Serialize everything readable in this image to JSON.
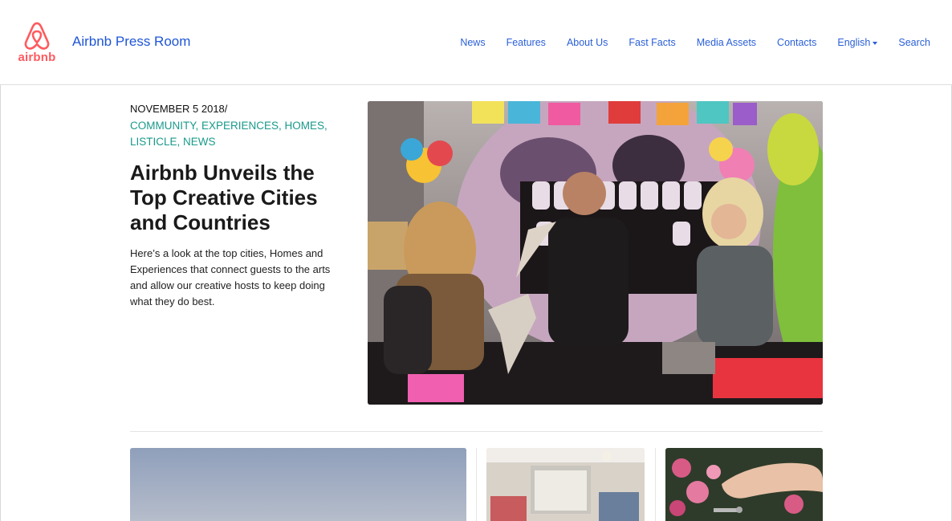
{
  "brand": {
    "logo_text": "airbnb",
    "site_title": "Airbnb Press Room",
    "accent": "#ff5a5f",
    "link_color": "#2a5fd8",
    "category_color": "#1a9a8a"
  },
  "nav": {
    "items": [
      {
        "label": "News"
      },
      {
        "label": "Features"
      },
      {
        "label": "About Us"
      },
      {
        "label": "Fast Facts"
      },
      {
        "label": "Media Assets"
      },
      {
        "label": "Contacts"
      },
      {
        "label": "English",
        "has_dropdown": true
      },
      {
        "label": "Search"
      }
    ]
  },
  "feature": {
    "date": "NOVEMBER 5 2018/",
    "categories": [
      "COMMUNITY",
      "EXPERIENCES",
      "HOMES",
      "LISTICLE",
      "NEWS"
    ],
    "categories_line1": "COMMUNITY, EXPERIENCES, HOMES,",
    "categories_line2": "LISTICLE, NEWS",
    "headline": "Airbnb Unveils the Top Creative Cities and Countries",
    "summary": "Here’s a look at the top cities, Homes and Experiences that connect guests to the arts and allow our creative hosts to keep doing what they do best.",
    "image_icon": "hero-photo-artisans-papel-picado"
  },
  "cards": [
    {
      "image_icon": "card-photo-landscape-sky"
    },
    {
      "image_icon": "card-photo-interior-room"
    },
    {
      "image_icon": "card-photo-hand-keys-flowers"
    }
  ]
}
